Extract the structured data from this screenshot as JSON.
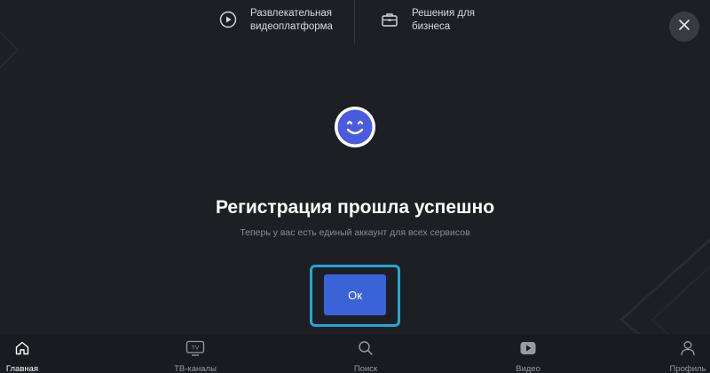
{
  "top_nav": {
    "video_platform": {
      "label": "Развлекательная\nвидеоплатформа",
      "icon": "play-circle-icon"
    },
    "business": {
      "label": "Решения для\nбизнеса",
      "icon": "briefcase-icon"
    }
  },
  "close": {
    "icon": "close-icon"
  },
  "dialog": {
    "icon": "smiley-icon",
    "title": "Регистрация прошла успешно",
    "subtitle": "Теперь у вас есть единый аккаунт для всех сервисов",
    "ok_label": "Ок"
  },
  "bottom_tabs": [
    {
      "label": "Главная",
      "icon": "home-icon",
      "active": true
    },
    {
      "label": "ТВ-каналы",
      "icon": "tv-icon",
      "active": false
    },
    {
      "label": "Поиск",
      "icon": "search-icon",
      "active": false
    },
    {
      "label": "Видео",
      "icon": "video-play-icon",
      "active": false
    },
    {
      "label": "Профиль",
      "icon": "profile-icon",
      "active": false
    }
  ],
  "colors": {
    "background": "#1e1e25",
    "accent_button": "#3a63d8",
    "focus_ring": "#1fa8d8",
    "smiley": "#4a5be0"
  }
}
